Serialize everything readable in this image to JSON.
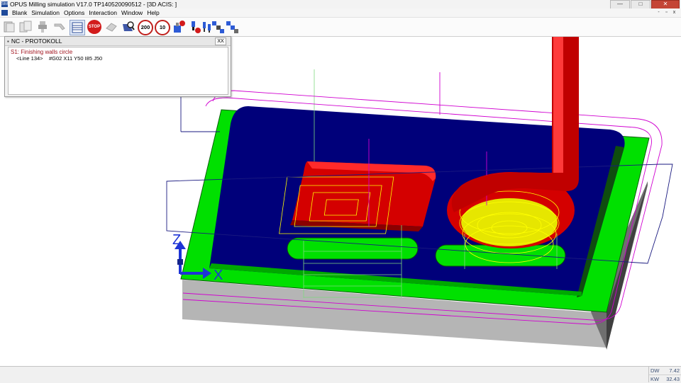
{
  "window": {
    "title": "OPUS Milling simulation V17.0  TP140520090512    - [3D ACIS: ]",
    "app_icon_text": "SM",
    "buttons": {
      "minimize": "—",
      "maximize": "□",
      "close": "✕"
    }
  },
  "menu": {
    "items": [
      "Blank",
      "Simulation",
      "Options",
      "Interaction",
      "Window",
      "Help"
    ],
    "mdi_buttons": {
      "minimize": "-",
      "restore": "▫",
      "close": "x"
    }
  },
  "toolbar": {
    "stop_label": "STOP",
    "speed_200": "200",
    "speed_10": "10",
    "icons": [
      "open-icon",
      "copy-icon",
      "tool-holder-icon",
      "tool-icon",
      "nc-table-icon",
      "stop-icon",
      "eraser-icon",
      "zoom-icon",
      "speed-200-icon",
      "speed-10-icon",
      "machine-stop-icon",
      "tool-change-icon",
      "tools-icon",
      "axes-icon",
      "axes-blue-icon"
    ]
  },
  "nc_panel": {
    "title": "NC - PROTOKOLL",
    "close_label": "XX",
    "step_text": "S1: Finishing walls circle",
    "line_text": "<Line 134>",
    "command_text": "#G02 X11 Y50 I85 J50"
  },
  "viewport": {
    "axis_z_label": "Z",
    "axis_x_label": "X",
    "colors": {
      "background": "#ffffff",
      "top_face": "#00e000",
      "pocket_floor": "#00007a",
      "side_face": "#b3b3b3",
      "tool": "#d40000",
      "toolpath_yellow": "#ffff00",
      "boundary_magenta": "#d000d0",
      "axis_blue": "#1d34d6"
    }
  },
  "status": {
    "dw_label": "DW",
    "dw_value": "7.42",
    "kw_label": "KW",
    "kw_value": "32.43"
  }
}
